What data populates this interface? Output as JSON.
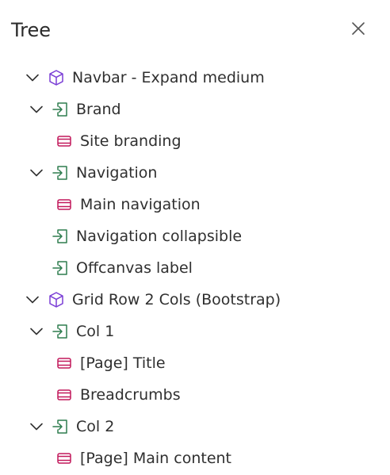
{
  "panel": {
    "title": "Tree"
  },
  "icons": {
    "close": "close-icon",
    "caret": "chevron-down-icon",
    "component": "cube-icon",
    "slot": "slot-enter-icon",
    "block": "block-icon"
  },
  "colors": {
    "component": "#7b3fd6",
    "slot": "#2e7d4f",
    "block": "#c2185b",
    "chevron": "#333333"
  },
  "tree": [
    {
      "label": "Navbar - Expand medium",
      "type": "component",
      "expanded": true
    },
    {
      "label": "Brand",
      "type": "slot",
      "expanded": true
    },
    {
      "label": "Site branding",
      "type": "block"
    },
    {
      "label": "Navigation",
      "type": "slot",
      "expanded": true
    },
    {
      "label": "Main navigation",
      "type": "block"
    },
    {
      "label": "Navigation collapsible",
      "type": "slot"
    },
    {
      "label": "Offcanvas label",
      "type": "slot"
    },
    {
      "label": "Grid Row 2 Cols (Bootstrap)",
      "type": "component",
      "expanded": true
    },
    {
      "label": "Col 1",
      "type": "slot",
      "expanded": true
    },
    {
      "label": "[Page] Title",
      "type": "block"
    },
    {
      "label": "Breadcrumbs",
      "type": "block"
    },
    {
      "label": "Col 2",
      "type": "slot",
      "expanded": true
    },
    {
      "label": "[Page] Main content",
      "type": "block"
    }
  ]
}
